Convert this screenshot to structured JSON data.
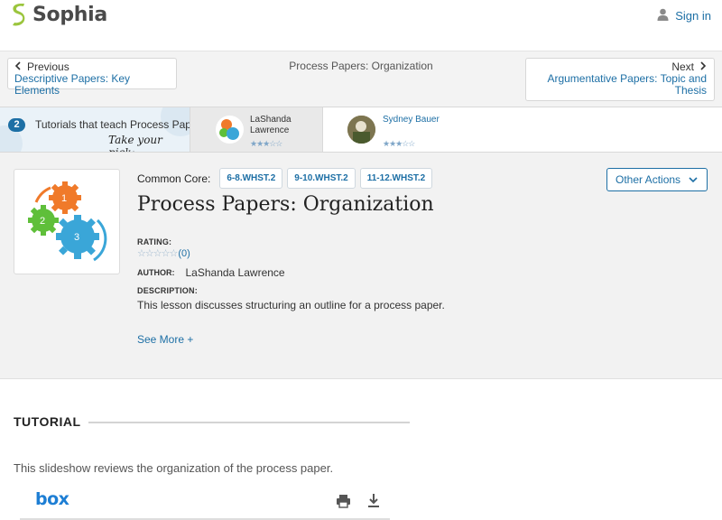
{
  "header": {
    "logo_text": "Sophia",
    "signin_label": "Sign in"
  },
  "nav": {
    "previous_label": "Previous",
    "previous_link": "Descriptive Papers: Key Elements",
    "current_title": "Process Papers: Organization",
    "next_label": "Next",
    "next_link_line1": "Argumentative Papers: Topic and",
    "next_link_line2": "Thesis"
  },
  "tutorials": {
    "count": "2",
    "promo_text": "Tutorials that teach Process Pap",
    "pick_text": "Take your pick:",
    "cards": [
      {
        "name_line1": "LaShanda",
        "name_line2": "Lawrence",
        "stars": "★★★☆☆"
      },
      {
        "name_line1": "Sydney Bauer",
        "name_line2": "",
        "stars": "★★★☆☆"
      }
    ]
  },
  "lesson": {
    "common_core_label": "Common Core:",
    "standards": [
      "6-8.WHST.2",
      "9-10.WHST.2",
      "11-12.WHST.2"
    ],
    "actions_label": "Other Actions",
    "title": "Process Papers: Organization",
    "rating_label": "RATING:",
    "rating_stars": "☆☆☆☆☆",
    "rating_count": "(0)",
    "author_label": "AUTHOR:",
    "author_name": "LaShanda Lawrence",
    "description_label": "DESCRIPTION:",
    "description": "This lesson discusses structuring an outline for a process paper.",
    "see_more": "See More +",
    "gear_numbers": [
      "1",
      "2",
      "3"
    ]
  },
  "tutorial_section": {
    "heading": "TUTORIAL",
    "intro": "This slideshow reviews the organization of the process paper.",
    "viewer_logo": "box"
  },
  "colors": {
    "accent": "#1d6fa5",
    "brand_green": "#9bc53d",
    "panel_bg": "#f2f2f2"
  }
}
